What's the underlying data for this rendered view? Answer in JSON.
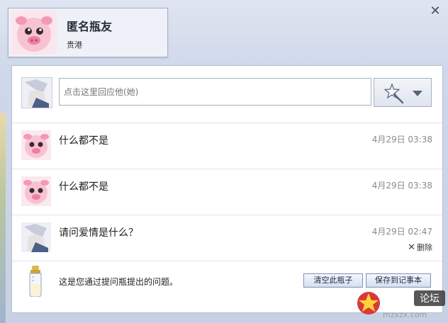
{
  "header": {
    "name": "匿名瓶友",
    "location": "贵港"
  },
  "reply": {
    "placeholder": "点击这里回应他(她)"
  },
  "messages": [
    {
      "text": "什么都不是",
      "time": "4月29日 03:38",
      "avatar": "pig"
    },
    {
      "text": "什么都不是",
      "time": "4月29日 03:38",
      "avatar": "pig"
    },
    {
      "text": "请问爱情是什么？",
      "time": "4月29日 02:47",
      "avatar": "anime",
      "delete_label": "删除"
    }
  ],
  "footer": {
    "note": "这是您通过提问瓶提出的问题。",
    "clear_label": "清空此瓶子",
    "save_label": "保存到记事本"
  },
  "watermark": {
    "brand": "论坛",
    "site": "mzxzx.com"
  },
  "colors": {
    "panel_bg": "#ffffff",
    "window_bg": "#cfd8ea",
    "button_border": "#7f90b6"
  },
  "icons": [
    "close-icon",
    "star-wand-icon",
    "dropdown-caret-icon",
    "delete-x-icon",
    "milk-bottle-icon"
  ]
}
